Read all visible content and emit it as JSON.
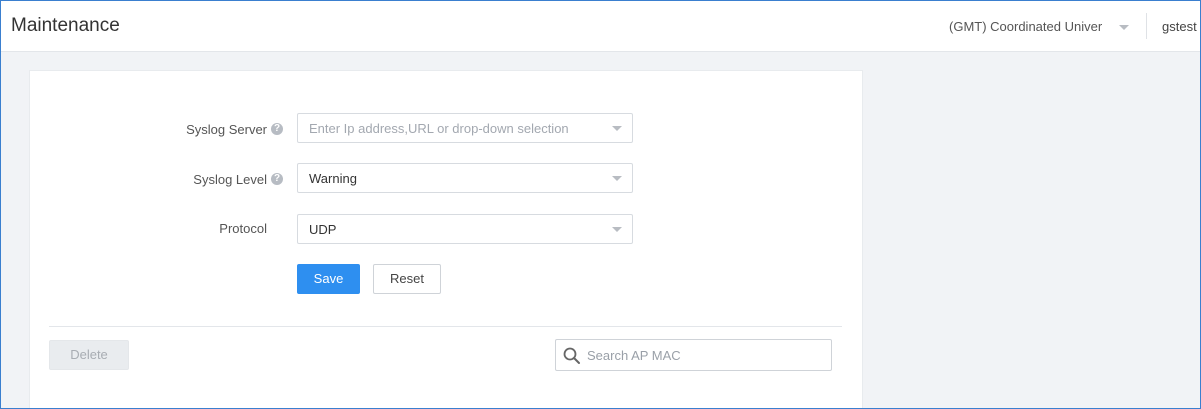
{
  "header": {
    "title": "Maintenance",
    "timezone": "(GMT) Coordinated Univer",
    "user": "gstest"
  },
  "form": {
    "syslog_server": {
      "label": "Syslog Server",
      "placeholder": "Enter Ip address,URL or drop-down selection"
    },
    "syslog_level": {
      "label": "Syslog Level",
      "value": "Warning"
    },
    "protocol": {
      "label": "Protocol",
      "value": "UDP"
    },
    "save_label": "Save",
    "reset_label": "Reset"
  },
  "table_toolbar": {
    "delete_label": "Delete",
    "search_placeholder": "Search AP MAC"
  },
  "colors": {
    "accent": "#2e8ff0",
    "frame_border": "#3a7fcf"
  }
}
